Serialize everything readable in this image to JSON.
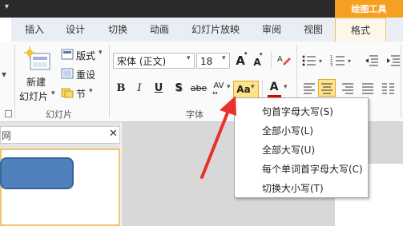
{
  "titlebar": {
    "tools_tab": "绘图工具"
  },
  "tabs": [
    "插入",
    "设计",
    "切换",
    "动画",
    "幻灯片放映",
    "审阅",
    "视图",
    "格式"
  ],
  "slides_group": {
    "new_slide": "新建",
    "new_slide2": "幻灯片",
    "layout": "版式",
    "reset": "重设",
    "section": "节",
    "label": "幻灯片"
  },
  "font_group": {
    "font_name": "宋体 (正文)",
    "font_size": "18",
    "grow": "A",
    "shrink": "A",
    "bold": "B",
    "italic": "I",
    "underline": "U",
    "shadow": "S",
    "strike": "abe",
    "spacing": "AV",
    "change_case": "Aa",
    "font_color": "A",
    "label": "字体"
  },
  "change_case_menu": [
    "句首字母大写(S)",
    "全部小写(L)",
    "全部大写(U)",
    "每个单词首字母大写(C)",
    "切换大小写(T)"
  ],
  "pane": {
    "tab_label": "网",
    "close": "✕"
  },
  "colors": {
    "accent": "#f5a020",
    "shape": "#4f81bd",
    "arrow": "#e8312a",
    "font_red": "#e00000"
  }
}
